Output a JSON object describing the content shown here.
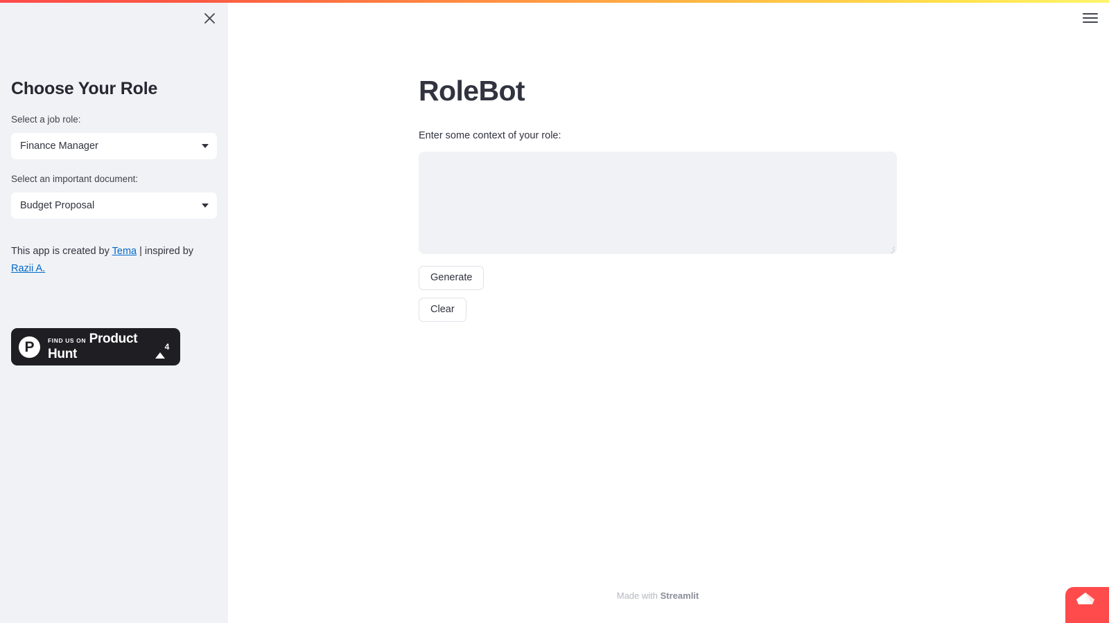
{
  "app": {
    "title": "RoleBot",
    "accent_color": "#ff4b4b",
    "sidebar_bg": "#f0f2f6"
  },
  "sidebar": {
    "close_icon": "close-icon",
    "heading": "Choose Your Role",
    "role_field": {
      "label": "Select a job role:",
      "value": "Finance Manager",
      "chevron_icon": "chevron-down-icon"
    },
    "document_field": {
      "label": "Select an important document:",
      "value": "Budget Proposal",
      "chevron_icon": "chevron-down-icon"
    },
    "credit": {
      "prefix": "This app is created by ",
      "link1": "Tema",
      "middle": " | inspired by ",
      "link2": "Razii A."
    },
    "product_hunt": {
      "logo_letter": "P",
      "kicker": "FIND US ON",
      "name": "Product Hunt",
      "upvote_icon": "upvote-triangle-icon",
      "count": "4"
    }
  },
  "main": {
    "menu_icon": "hamburger-menu-icon",
    "page_title": "RoleBot",
    "context_label": "Enter some context of your role:",
    "context_value": "",
    "context_placeholder": "",
    "generate_label": "Generate",
    "clear_label": "Clear"
  },
  "footer": {
    "made_with": "Made with ",
    "brand": "Streamlit"
  },
  "floating_widget": {
    "icon": "paper-boat-icon",
    "color": "#ff4b4b"
  }
}
